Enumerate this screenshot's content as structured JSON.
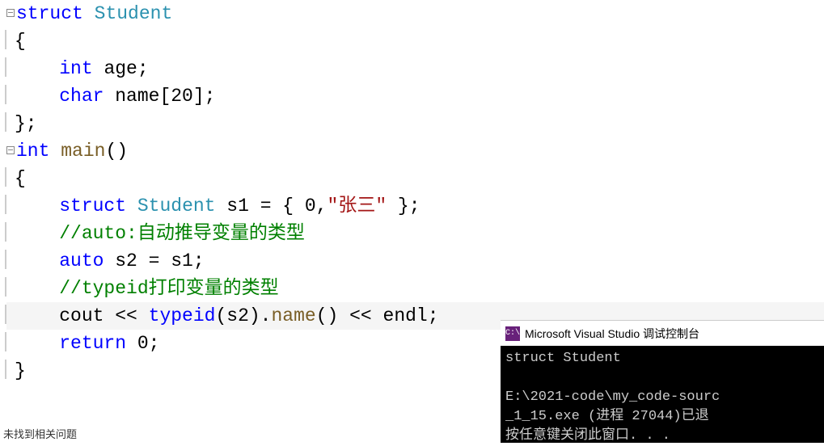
{
  "code": {
    "l1": {
      "kw": "struct",
      "type": "Student"
    },
    "l2": "{",
    "l3": {
      "indent": "    ",
      "kw": "int",
      "ident": " age;"
    },
    "l4": {
      "indent": "    ",
      "kw": "char",
      "ident": " name[20];"
    },
    "l5": "};",
    "l6": {
      "kw": "int",
      "func": "main",
      "rest": "()"
    },
    "l7": "{",
    "l8": {
      "indent": "    ",
      "kw": "struct",
      "type": "Student",
      "ident": " s1 = { 0,",
      "str": "\"张三\"",
      "rest": " };"
    },
    "l9": {
      "indent": "    ",
      "comment": "//auto:自动推导变量的类型"
    },
    "l10": {
      "indent": "    ",
      "kw": "auto",
      "rest": " s2 = s1;"
    },
    "l11": {
      "indent": "    ",
      "comment": "//typeid打印变量的类型"
    },
    "l12": {
      "indent": "    ",
      "ident1": "cout << ",
      "kw": "typeid",
      "rest1": "(s2).",
      "func": "name",
      "rest2": "() << endl;"
    },
    "l13": {
      "indent": "    ",
      "kw": "return",
      "rest": " 0;"
    },
    "l14": "}"
  },
  "console": {
    "title": "Microsoft Visual Studio 调试控制台",
    "icon": "C:\\",
    "line1": "struct Student",
    "line2": "",
    "line3": "E:\\2021-code\\my_code-sourc",
    "line4": "_1_15.exe (进程 27044)已退",
    "line5": "按任意键关闭此窗口. . ."
  },
  "status": "未找到相关问题"
}
